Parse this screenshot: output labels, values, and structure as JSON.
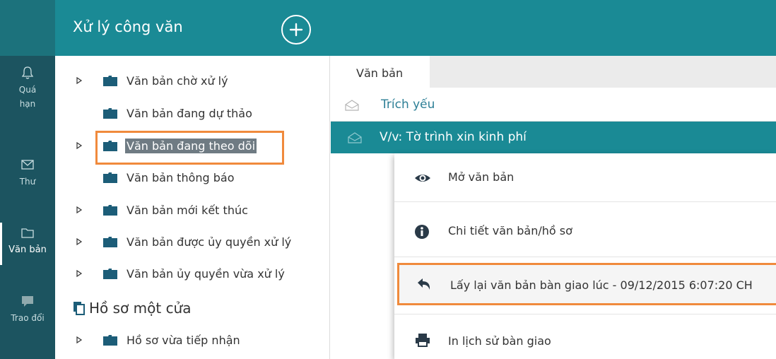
{
  "header": {
    "title": "Xử lý công văn",
    "add_icon": "plus-circle-icon"
  },
  "rail": {
    "items": [
      {
        "label": "Quá hạn",
        "icon": "bell-icon"
      },
      {
        "label": "Thư",
        "icon": "mail-icon"
      },
      {
        "label": "Văn bản",
        "icon": "folder-icon",
        "active": true
      },
      {
        "label": "Trao đổi",
        "icon": "chat-icon"
      }
    ]
  },
  "tree": {
    "items": [
      {
        "label": "Văn bản chờ xử lý",
        "expandable": true
      },
      {
        "label": "Văn bản đang dự thảo",
        "expandable": false
      },
      {
        "label": "Văn bản đang theo dõi",
        "expandable": true,
        "selected": true
      },
      {
        "label": "Văn bản thông báo",
        "expandable": false
      },
      {
        "label": "Văn bản mới kết thúc",
        "expandable": true
      },
      {
        "label": "Văn bản được ủy quyền xử lý",
        "expandable": true
      },
      {
        "label": "Văn bản ủy quyền vừa xử lý",
        "expandable": true
      }
    ],
    "section": {
      "title": "Hồ sơ một cửa",
      "items": [
        {
          "label": "Hồ sơ vừa tiếp nhận",
          "expandable": true
        }
      ]
    }
  },
  "content": {
    "tab": "Văn bản",
    "column_header": "Trích yếu",
    "selected_row": "V/v: Tờ trình xin kinh phí"
  },
  "context_menu": {
    "items": [
      {
        "label": "Mở văn bản",
        "icon": "eye-icon"
      },
      {
        "label": "Chi tiết văn bản/hồ sơ",
        "icon": "info-icon"
      },
      {
        "label": "Lấy lại văn bản bàn giao lúc - 09/12/2015 6:07:20 CH",
        "icon": "undo-arrow-icon",
        "highlighted": true
      },
      {
        "label": "In lịch sử bàn giao",
        "icon": "printer-icon"
      }
    ]
  },
  "colors": {
    "header_teal": "#1a8a95",
    "rail_dark": "#1c5460",
    "highlight_orange": "#f08a3c",
    "link_blue": "#2d7f96"
  }
}
